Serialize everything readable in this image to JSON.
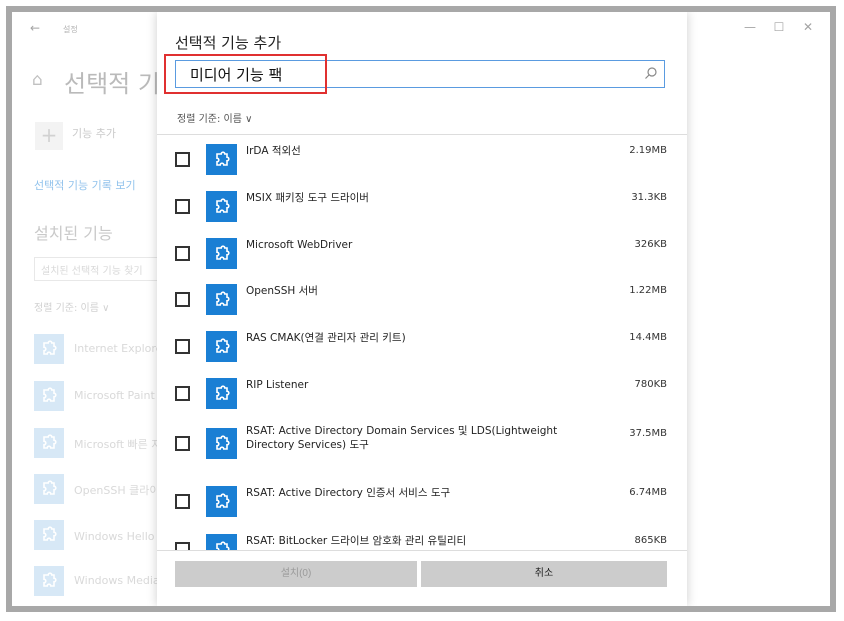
{
  "window": {
    "title": "설정",
    "back_glyph": "←",
    "minimize_glyph": "—",
    "maximize_glyph": "☐",
    "close_glyph": "✕"
  },
  "background": {
    "page_title": "선택적 기능",
    "add_feature_label": "기능 추가",
    "history_link": "선택적 기능 기록 보기",
    "installed_title": "설치된 기능",
    "installed_search_placeholder": "설치된 선택적 기능 찾기",
    "sort_label": "정렬 기준: 이름 ∨",
    "installed_items": [
      {
        "label": "Internet Explorer"
      },
      {
        "label": "Microsoft Paint"
      },
      {
        "label": "Microsoft 빠른 지"
      },
      {
        "label": "OpenSSH 클라이"
      },
      {
        "label": "Windows Hello 얼"
      },
      {
        "label": "Windows Media"
      }
    ]
  },
  "dialog": {
    "title": "선택적 기능 추가",
    "search_value": "미디어 기능 팩",
    "sort_label": "정렬 기준: 이름 ∨",
    "features": [
      {
        "name": "IrDA 적외선",
        "size": "2.19MB"
      },
      {
        "name": "MSIX 패키징 도구 드라이버",
        "size": "31.3KB"
      },
      {
        "name": "Microsoft WebDriver",
        "size": "326KB"
      },
      {
        "name": "OpenSSH 서버",
        "size": "1.22MB"
      },
      {
        "name": "RAS CMAK(연결 관리자 관리 키트)",
        "size": "14.4MB"
      },
      {
        "name": "RIP Listener",
        "size": "780KB"
      },
      {
        "name": "RSAT: Active Directory Domain Services 및 LDS(Lightweight Directory Services) 도구",
        "size": "37.5MB"
      },
      {
        "name": "RSAT: Active Directory 인증서 서비스 도구",
        "size": "6.74MB"
      },
      {
        "name": "RSAT: BitLocker 드라이브 암호화 관리 유틸리티",
        "size": "865KB"
      }
    ],
    "install_button": "설치(0)",
    "cancel_button": "취소"
  },
  "colors": {
    "accent": "#1a7fd4",
    "highlight": "#e03030",
    "link": "#0a78d4"
  }
}
